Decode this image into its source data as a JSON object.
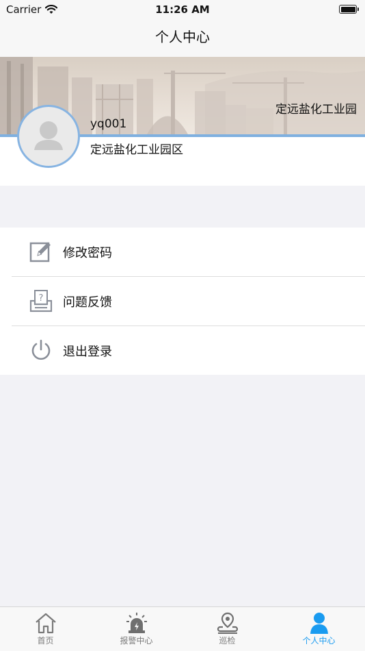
{
  "status_bar": {
    "carrier": "Carrier",
    "time": "11:26 AM"
  },
  "nav": {
    "title": "个人中心"
  },
  "profile": {
    "banner_text": "定远盐化工业园",
    "username": "yq001",
    "organization": "定远盐化工业园区"
  },
  "menu": {
    "items": [
      {
        "label": "修改密码",
        "icon": "edit-icon"
      },
      {
        "label": "问题反馈",
        "icon": "feedback-icon"
      },
      {
        "label": "退出登录",
        "icon": "power-icon"
      }
    ]
  },
  "tab_bar": {
    "tabs": [
      {
        "label": "首页",
        "icon": "home-icon"
      },
      {
        "label": "报警中心",
        "icon": "alarm-icon"
      },
      {
        "label": "巡检",
        "icon": "location-icon"
      },
      {
        "label": "个人中心",
        "icon": "person-icon"
      }
    ],
    "active_index": 3
  },
  "colors": {
    "accent": "#1a9bf0",
    "avatar_border": "#87b4e2",
    "icon_gray": "#8a8f99"
  }
}
